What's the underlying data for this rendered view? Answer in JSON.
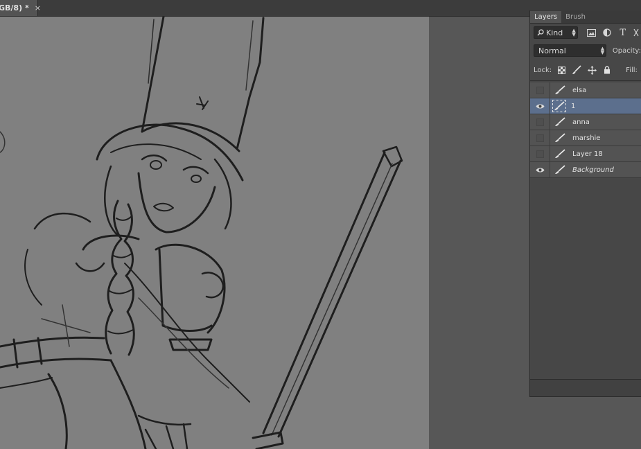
{
  "document": {
    "tab_title": "GB/8) *",
    "close_glyph": "×"
  },
  "layers_panel": {
    "tabs": [
      {
        "label": "Layers",
        "active": true
      },
      {
        "label": "Brush",
        "active": false
      }
    ],
    "kind_filter": {
      "label": "Kind",
      "icon": "search-icon"
    },
    "filter_icons": [
      "image-filter-icon",
      "adjustment-filter-icon",
      "type-filter-icon",
      "shape-filter-icon"
    ],
    "type_glyph": "T",
    "blend_mode": "Normal",
    "opacity_label": "Opacity:",
    "lock_label": "Lock:",
    "fill_label": "Fill:",
    "lock_icons": [
      "lock-transparent-icon",
      "lock-paint-icon",
      "lock-position-icon",
      "lock-all-icon"
    ],
    "layers": [
      {
        "name": "elsa",
        "visible": false,
        "selected": false,
        "italic": false
      },
      {
        "name": "1",
        "visible": true,
        "selected": true,
        "italic": false
      },
      {
        "name": "anna",
        "visible": false,
        "selected": false,
        "italic": false
      },
      {
        "name": "marshie",
        "visible": false,
        "selected": false,
        "italic": false
      },
      {
        "name": "Layer 18",
        "visible": false,
        "selected": false,
        "italic": false
      },
      {
        "name": "Background",
        "visible": true,
        "selected": false,
        "italic": true
      }
    ]
  },
  "colors": {
    "canvas": "#808080",
    "pasteboard": "#575757",
    "panel": "#474747",
    "selected_layer": "#5c6f8d"
  }
}
